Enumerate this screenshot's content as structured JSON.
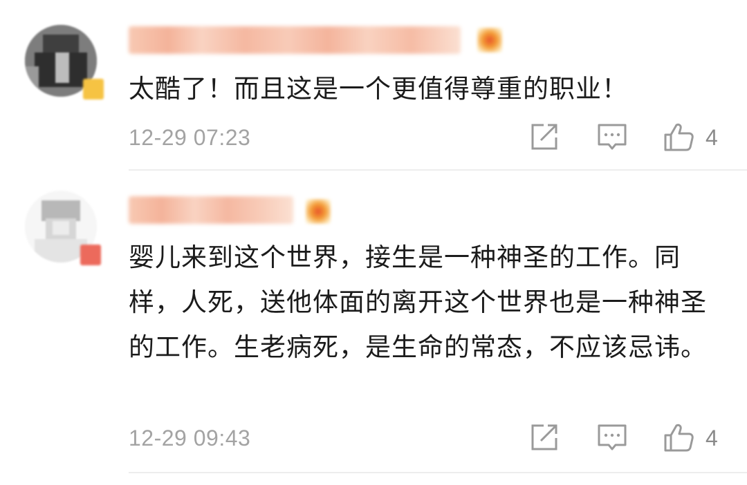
{
  "comments": [
    {
      "text": "太酷了！而且这是一个更值得尊重的职业！",
      "time": "12-29 07:23",
      "likes": "4",
      "icons": [
        "share-icon",
        "reply-icon",
        "like-icon"
      ]
    },
    {
      "text": "婴儿来到这个世界，接生是一种神圣的工作。同样，人死，送他体面的离开这个世界也是一种神圣的工作。生老病死，是生命的常态，不应该忌讳。",
      "time": "12-29 09:43",
      "likes": "4",
      "icons": [
        "share-icon",
        "reply-icon",
        "like-icon"
      ]
    }
  ],
  "colors": {
    "text": "#1b1b1b",
    "meta": "#a3a3a3",
    "icon": "#9a9a9a",
    "divider": "#ededed",
    "vip_badge": "#f5a623"
  }
}
